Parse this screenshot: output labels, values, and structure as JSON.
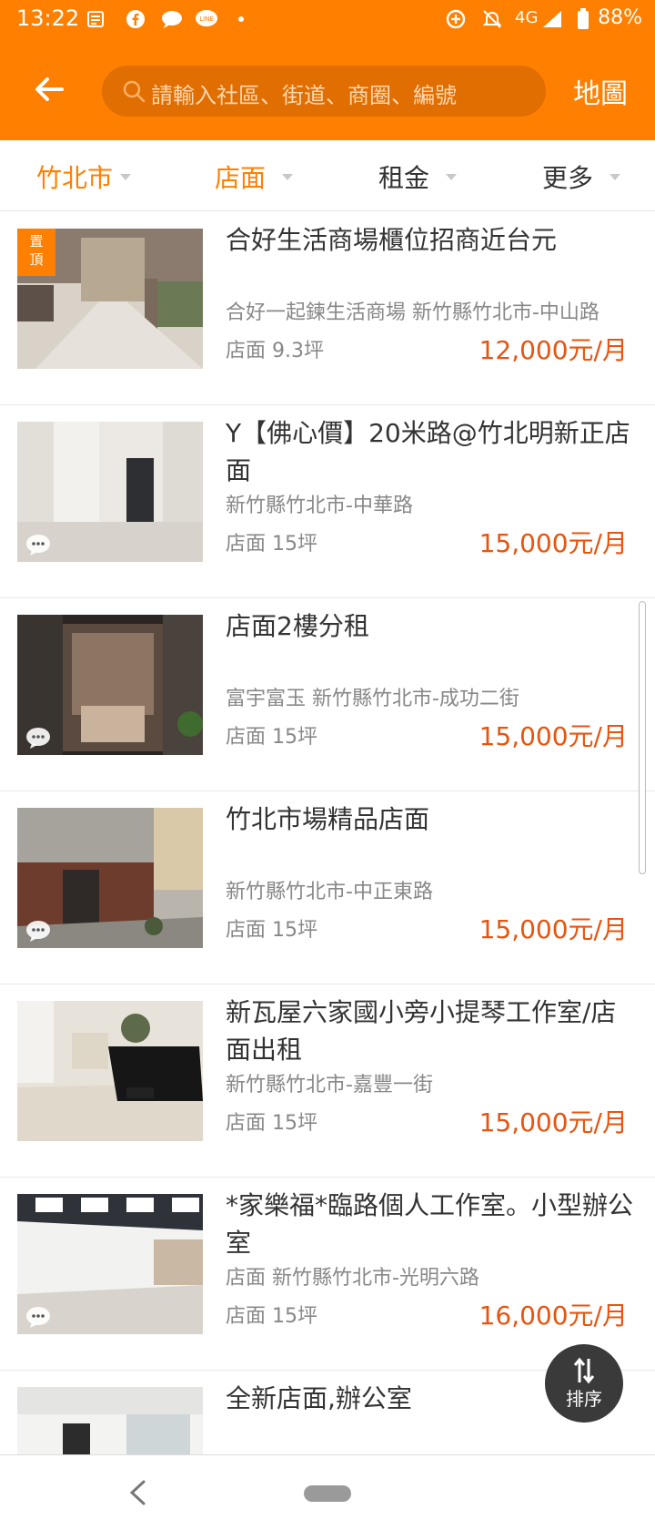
{
  "status_bar": {
    "time": "13:22",
    "network": "4G",
    "battery": "88%",
    "icons": [
      "news-icon",
      "facebook-icon",
      "message-icon",
      "line-icon",
      "dot-icon",
      "data-saver-icon",
      "mute-icon",
      "signal-icon",
      "battery-icon"
    ]
  },
  "header": {
    "search_placeholder": "請輸入社區、街道、商圈、編號",
    "map_label": "地圖",
    "accent": "#ff8000"
  },
  "filters": [
    {
      "label": "竹北市",
      "active": true
    },
    {
      "label": "店面",
      "active": true
    },
    {
      "label": "租金",
      "active": false
    },
    {
      "label": "更多",
      "active": false
    }
  ],
  "listings": [
    {
      "title": "合好生活商場櫃位招商近台元",
      "subtitle": "合好一起鍊生活商場 新竹縣竹北市-中山路",
      "meta": "店面 9.3坪",
      "price": "12,000元/月",
      "badge": "置頂"
    },
    {
      "title": "Y【佛心價】20米路@竹北明新正店面",
      "subtitle": "新竹縣竹北市-中華路",
      "meta": "店面 15坪",
      "price": "15,000元/月"
    },
    {
      "title": "店面2樓分租",
      "subtitle": "富宇富玉 新竹縣竹北市-成功二街",
      "meta": "店面 15坪",
      "price": "15,000元/月"
    },
    {
      "title": "竹北市場精品店面",
      "subtitle": "新竹縣竹北市-中正東路",
      "meta": "店面 15坪",
      "price": "15,000元/月"
    },
    {
      "title": "新瓦屋六家國小旁小提琴工作室/店面出租",
      "subtitle": "新竹縣竹北市-嘉豐一街",
      "meta": "店面 15坪",
      "price": "15,000元/月"
    },
    {
      "title": "*家樂福*臨路個人工作室。小型辦公室",
      "subtitle": "店面 新竹縣竹北市-光明六路",
      "meta": "店面 15坪",
      "price": "16,000元/月"
    },
    {
      "title": "全新店面,辦公室",
      "subtitle": "",
      "meta": "",
      "price": ""
    }
  ],
  "sort_label": "排序",
  "price_color": "#e8540e"
}
